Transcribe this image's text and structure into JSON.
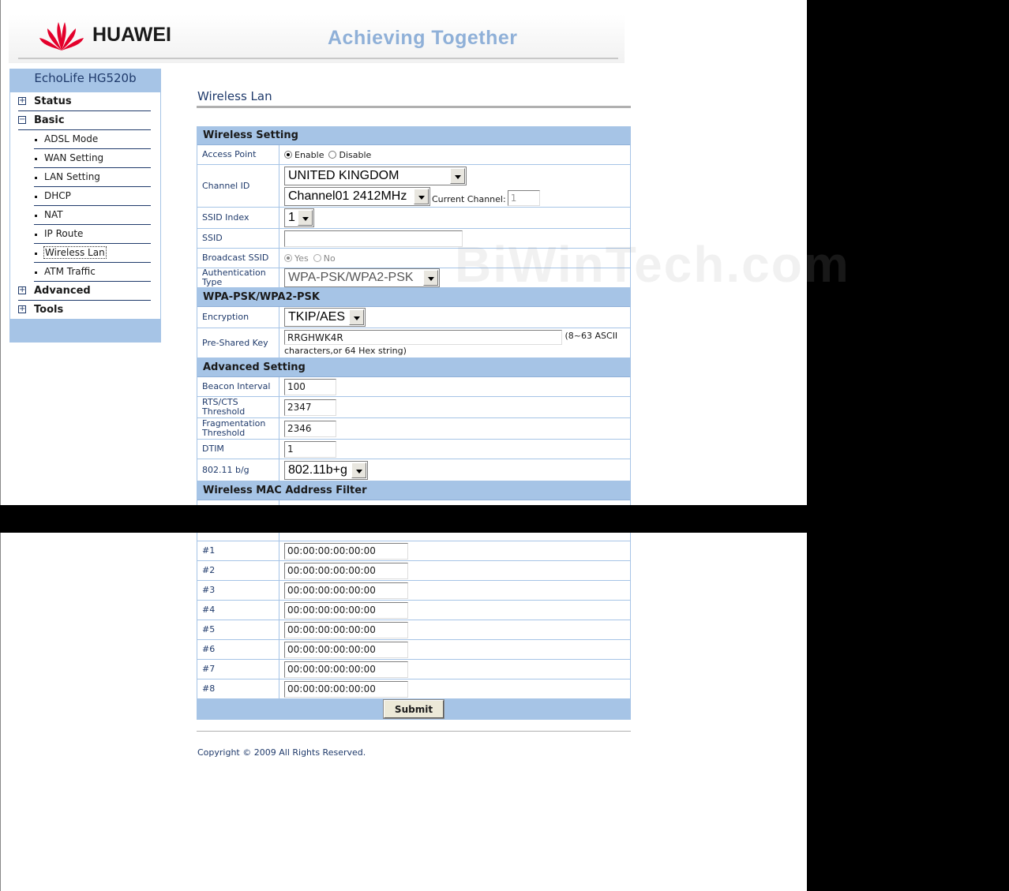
{
  "header": {
    "logo_text": "HUAWEI",
    "slogan": "Achieving Together",
    "brand_color": "#e4002b"
  },
  "sidebar": {
    "device_name": "EchoLife HG520b",
    "menu": [
      {
        "label": "Status",
        "toggle": "+"
      },
      {
        "label": "Basic",
        "toggle": "−"
      },
      {
        "label": "Advanced",
        "toggle": "+"
      },
      {
        "label": "Tools",
        "toggle": "+"
      }
    ],
    "basic_items": [
      {
        "label": "ADSL Mode"
      },
      {
        "label": "WAN Setting"
      },
      {
        "label": "LAN Setting"
      },
      {
        "label": "DHCP"
      },
      {
        "label": "NAT"
      },
      {
        "label": "IP Route"
      },
      {
        "label": "Wireless Lan"
      },
      {
        "label": "ATM Traffic"
      }
    ]
  },
  "main": {
    "title": "Wireless Lan",
    "sections": {
      "wireless_setting": "Wireless Setting",
      "wpa": "WPA-PSK/WPA2-PSK",
      "advanced": "Advanced Setting",
      "mac_filter": "Wireless MAC Address Filter"
    },
    "access_point": {
      "label": "Access Point",
      "enable": "Enable",
      "disable": "Disable",
      "selected": "Enable"
    },
    "channel_id": {
      "label": "Channel ID",
      "country": "UNITED KINGDOM",
      "channel": "Channel01 2412MHz",
      "current_label": "Current Channel:",
      "current_value": "1"
    },
    "ssid_index": {
      "label": "SSID Index",
      "value": "1"
    },
    "ssid": {
      "label": "SSID",
      "value": ""
    },
    "broadcast_ssid": {
      "label": "Broadcast SSID",
      "yes": "Yes",
      "no": "No",
      "selected": "Yes"
    },
    "auth_type": {
      "label": "Authentication Type",
      "value": "WPA-PSK/WPA2-PSK"
    },
    "encryption": {
      "label": "Encryption",
      "value": "TKIP/AES"
    },
    "psk": {
      "label": "Pre-Shared Key",
      "value": "RRGHWK4R",
      "hint": "(8~63 ASCII characters,or 64 Hex string)"
    },
    "beacon": {
      "label": "Beacon Interval",
      "value": "100"
    },
    "rts": {
      "label": "RTS/CTS Threshold",
      "value": "2347"
    },
    "frag": {
      "label": "Fragmentation Threshold",
      "value": "2346"
    },
    "dtim": {
      "label": "DTIM",
      "value": "1"
    },
    "mode": {
      "label": "802.11 b/g",
      "value": "802.11b+g"
    },
    "mac_entries": [
      {
        "label": "#1",
        "value": "00:00:00:00:00:00"
      },
      {
        "label": "#2",
        "value": "00:00:00:00:00:00"
      },
      {
        "label": "#3",
        "value": "00:00:00:00:00:00"
      },
      {
        "label": "#4",
        "value": "00:00:00:00:00:00"
      },
      {
        "label": "#5",
        "value": "00:00:00:00:00:00"
      },
      {
        "label": "#6",
        "value": "00:00:00:00:00:00"
      },
      {
        "label": "#7",
        "value": "00:00:00:00:00:00"
      },
      {
        "label": "#8",
        "value": "00:00:00:00:00:00"
      }
    ],
    "submit": "Submit",
    "copyright": "Copyright © 2009 All Rights Reserved.",
    "watermark": "BiWinTech.com"
  }
}
